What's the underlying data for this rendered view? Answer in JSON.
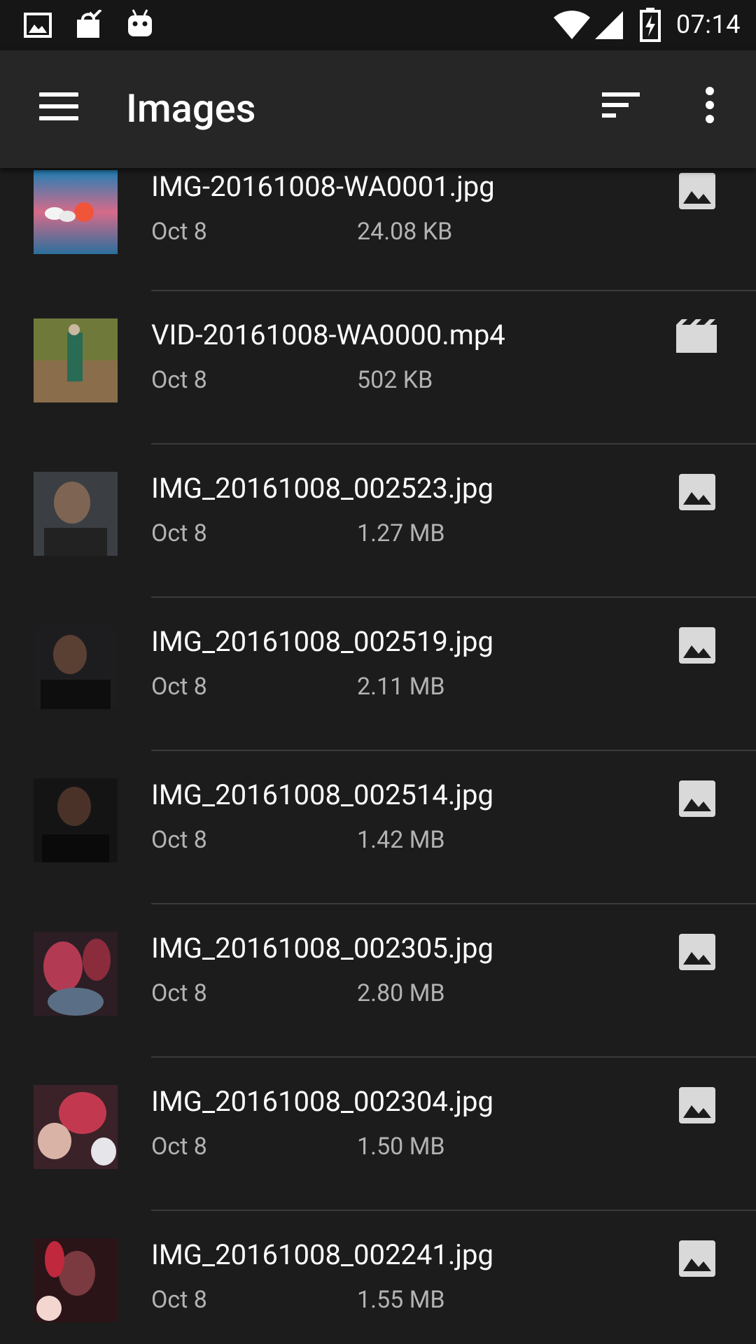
{
  "status_bar": {
    "time": "07:14"
  },
  "app_bar": {
    "title": "Images"
  },
  "items": [
    {
      "name": "IMG-20161008-WA0001.jpg",
      "date": "Oct 8",
      "size": "24.08 KB",
      "type_icon": "image-icon"
    },
    {
      "name": "VID-20161008-WA0000.mp4",
      "date": "Oct 8",
      "size": "502 KB",
      "type_icon": "video-icon"
    },
    {
      "name": "IMG_20161008_002523.jpg",
      "date": "Oct 8",
      "size": "1.27 MB",
      "type_icon": "image-icon"
    },
    {
      "name": "IMG_20161008_002519.jpg",
      "date": "Oct 8",
      "size": "2.11 MB",
      "type_icon": "image-icon"
    },
    {
      "name": "IMG_20161008_002514.jpg",
      "date": "Oct 8",
      "size": "1.42 MB",
      "type_icon": "image-icon"
    },
    {
      "name": "IMG_20161008_002305.jpg",
      "date": "Oct 8",
      "size": "2.80 MB",
      "type_icon": "image-icon"
    },
    {
      "name": "IMG_20161008_002304.jpg",
      "date": "Oct 8",
      "size": "1.50 MB",
      "type_icon": "image-icon"
    },
    {
      "name": "IMG_20161008_002241.jpg",
      "date": "Oct 8",
      "size": "1.55 MB",
      "type_icon": "image-icon"
    }
  ],
  "colors": {
    "background": "#1c1c1c",
    "app_bar": "#262626",
    "status_bar": "#161616",
    "secondary_text": "#b3b3b3",
    "icon_gray": "#d9d9d9"
  }
}
